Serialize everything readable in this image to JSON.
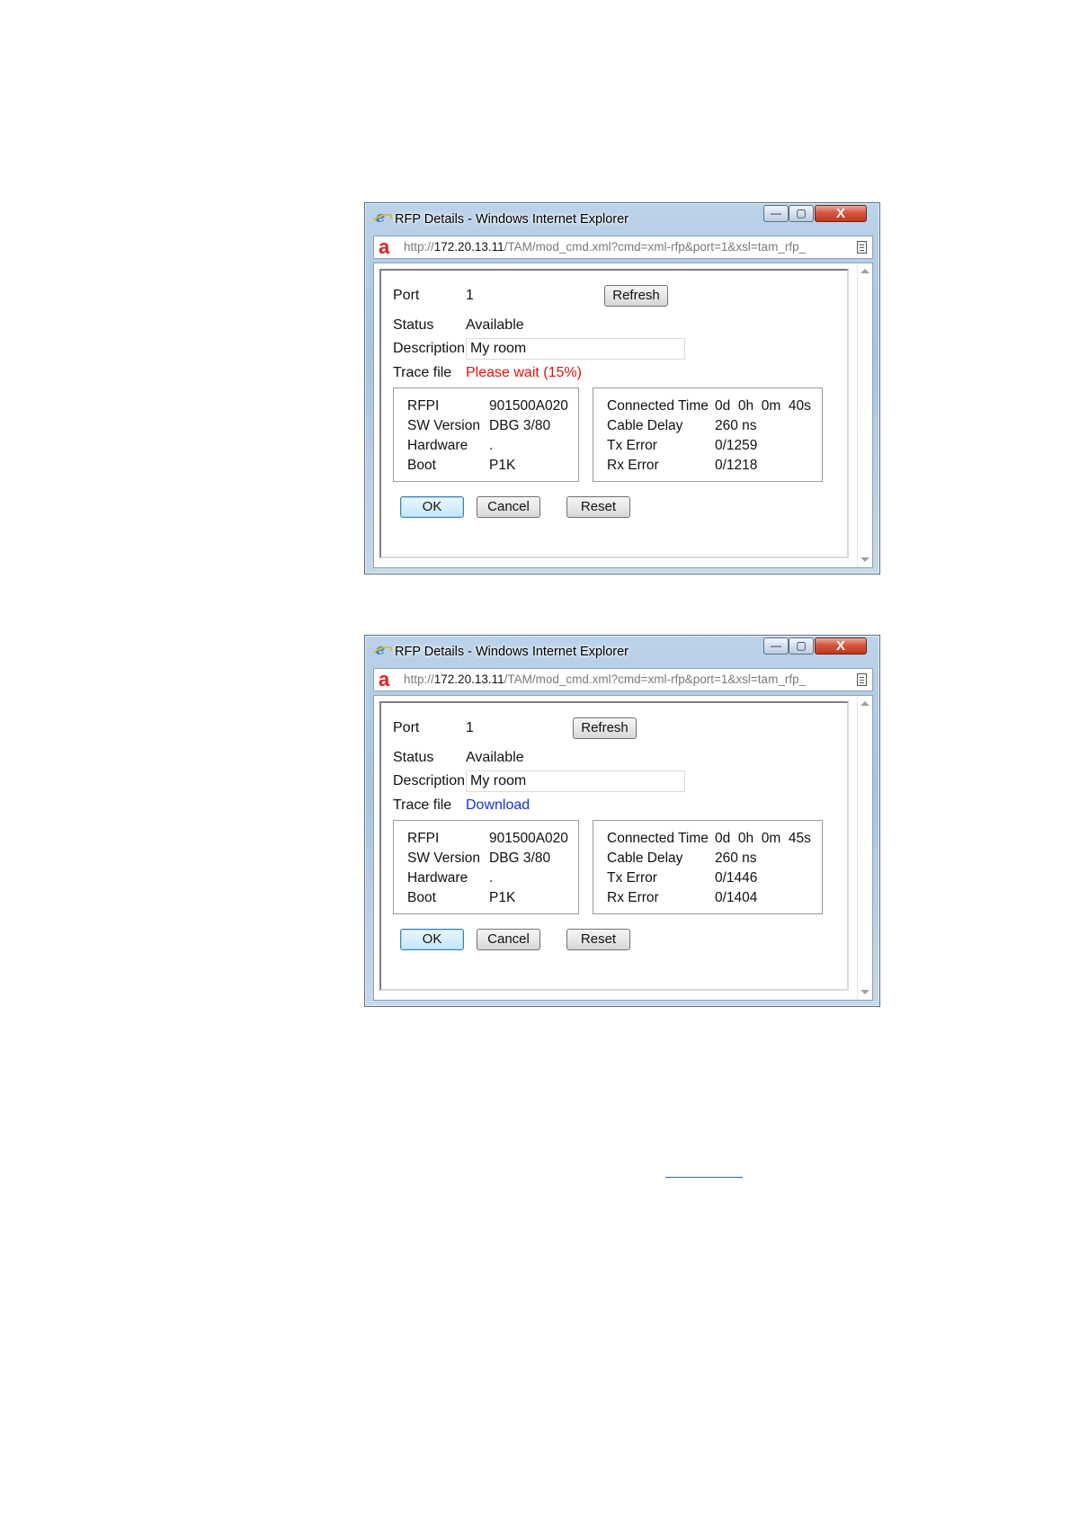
{
  "windows": [
    {
      "title": "RFP Details - Windows Internet Explorer",
      "url_prefix": "http://",
      "url_host": "172.20.13.11",
      "url_rest": "/TAM/mod_cmd.xml?cmd=xml-rfp&port=1&xsl=tam_rfp_",
      "port_label": "Port",
      "port_value": "1",
      "refresh_label": "Refresh",
      "status_label": "Status",
      "status_value": "Available",
      "description_label": "Description",
      "description_value": "My room",
      "trace_label": "Trace file",
      "trace_value": "Please wait (15%)",
      "left_box": [
        {
          "key": "RFPI",
          "value": "901500A020"
        },
        {
          "key": "SW Version",
          "value": "DBG 3/80"
        },
        {
          "key": "Hardware",
          "value": "."
        },
        {
          "key": "Boot",
          "value": "P1K"
        }
      ],
      "right_box": [
        {
          "key": "Connected Time",
          "value": "0d  0h  0m  40s"
        },
        {
          "key": "Cable Delay",
          "value": "260 ns"
        },
        {
          "key": "Tx Error",
          "value": "0/1259"
        },
        {
          "key": "Rx Error",
          "value": "0/1218"
        }
      ],
      "ok_label": "OK",
      "cancel_label": "Cancel",
      "reset_label": "Reset"
    },
    {
      "title": "RFP Details - Windows Internet Explorer",
      "url_prefix": "http://",
      "url_host": "172.20.13.11",
      "url_rest": "/TAM/mod_cmd.xml?cmd=xml-rfp&port=1&xsl=tam_rfp_",
      "port_label": "Port",
      "port_value": "1",
      "refresh_label": "Refresh",
      "status_label": "Status",
      "status_value": "Available",
      "description_label": "Description",
      "description_value": "My room",
      "trace_label": "Trace file",
      "trace_value": "Download",
      "left_box": [
        {
          "key": "RFPI",
          "value": "901500A020"
        },
        {
          "key": "SW Version",
          "value": "DBG 3/80"
        },
        {
          "key": "Hardware",
          "value": "."
        },
        {
          "key": "Boot",
          "value": "P1K"
        }
      ],
      "right_box": [
        {
          "key": "Connected Time",
          "value": "0d  0h  0m  45s"
        },
        {
          "key": "Cable Delay",
          "value": "260 ns"
        },
        {
          "key": "Tx Error",
          "value": "0/1446"
        },
        {
          "key": "Rx Error",
          "value": "0/1404"
        }
      ],
      "ok_label": "OK",
      "cancel_label": "Cancel",
      "reset_label": "Reset"
    }
  ],
  "icons": {
    "window_close_glyph": "X",
    "window_minimize_glyph": "—",
    "window_maximize_glyph": "▢",
    "ie_glyph": "e",
    "addr_logo_glyph": "a"
  },
  "colors": {
    "trace_wait": "#e01010",
    "trace_link": "#1a2fd8"
  }
}
